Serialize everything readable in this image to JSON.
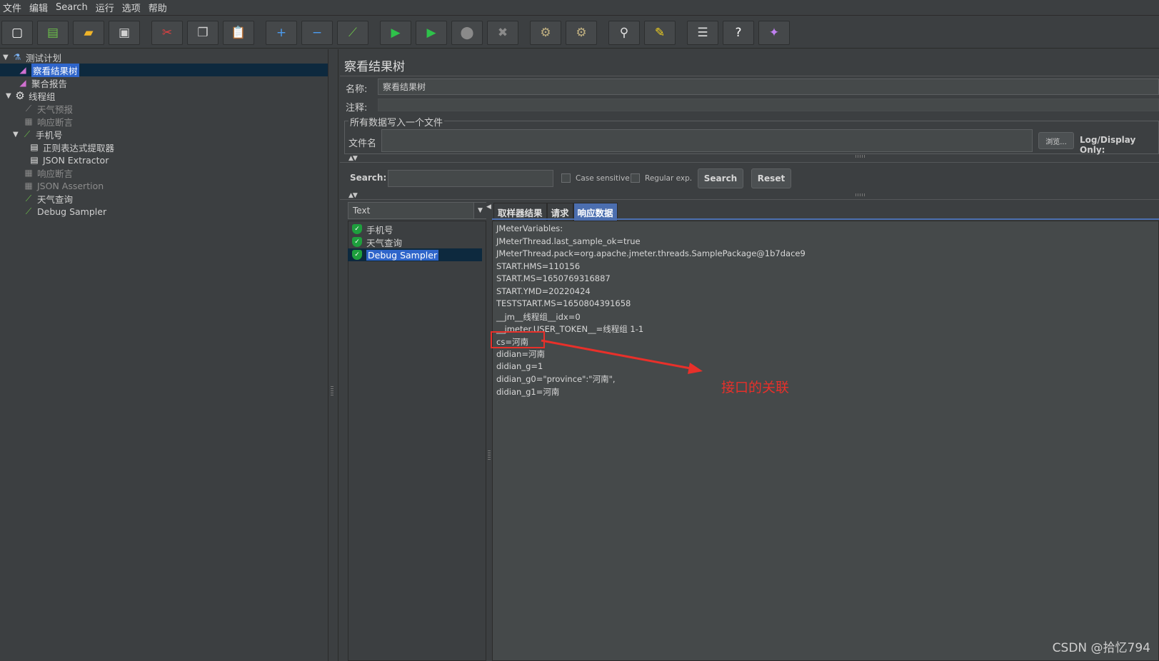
{
  "menu": [
    "文件",
    "编辑",
    "Search",
    "运行",
    "选项",
    "帮助"
  ],
  "toolbar": [
    {
      "icon": "new-icon",
      "glyph": "▢",
      "color": "#ffffff"
    },
    {
      "icon": "templates-icon",
      "glyph": "▤",
      "color": "#6cc04a"
    },
    {
      "icon": "open-icon",
      "glyph": "▰",
      "color": "#f0b429"
    },
    {
      "icon": "save-icon",
      "glyph": "▣",
      "color": "#d0d0d0"
    },
    {
      "icon": "cut-icon",
      "glyph": "✂",
      "color": "#e04040"
    },
    {
      "icon": "copy-icon",
      "glyph": "❐",
      "color": "#d0d0d0"
    },
    {
      "icon": "paste-icon",
      "glyph": "📋",
      "color": "#f0b429"
    },
    {
      "icon": "expand-icon",
      "glyph": "+",
      "color": "#4c9cf0"
    },
    {
      "icon": "collapse-icon",
      "glyph": "−",
      "color": "#4c9cf0"
    },
    {
      "icon": "toggle-icon",
      "glyph": "⟋",
      "color": "#6cc04a"
    },
    {
      "icon": "start-icon",
      "glyph": "▶",
      "color": "#2ec24a"
    },
    {
      "icon": "start-no-pause-icon",
      "glyph": "▶",
      "color": "#2ec24a"
    },
    {
      "icon": "stop-icon",
      "glyph": "⬤",
      "color": "#8a8a8a"
    },
    {
      "icon": "shutdown-icon",
      "glyph": "✖",
      "color": "#8a8a8a"
    },
    {
      "icon": "clear-icon",
      "glyph": "⚙",
      "color": "#c0b080"
    },
    {
      "icon": "clear-all-icon",
      "glyph": "⚙",
      "color": "#c0b080"
    },
    {
      "icon": "search-icon",
      "glyph": "⚲",
      "color": "#e0e0e0"
    },
    {
      "icon": "reset-search-icon",
      "glyph": "✎",
      "color": "#f0d020"
    },
    {
      "icon": "function-helper-icon",
      "glyph": "☰",
      "color": "#e0e0e0"
    },
    {
      "icon": "help-icon",
      "glyph": "?",
      "color": "#ffffff"
    },
    {
      "icon": "remote-icon",
      "glyph": "✦",
      "color": "#c080f0"
    }
  ],
  "tree": {
    "test_plan": "测试计划",
    "view_results_tree": "察看结果树",
    "aggregate_report": "聚合报告",
    "thread_group": "线程组",
    "weather_forecast": "天气预报",
    "response_assertion_1": "响应断言",
    "phone_number": "手机号",
    "regex_extractor": "正则表达式提取器",
    "json_extractor": "JSON Extractor",
    "response_assertion_2": "响应断言",
    "json_assertion": "JSON Assertion",
    "weather_query": "天气查询",
    "debug_sampler": "Debug Sampler"
  },
  "panel": {
    "title": "察看结果树",
    "name_label": "名称:",
    "name_value": "察看结果树",
    "comment_label": "注释:",
    "comment_value": "",
    "file_group_title": "所有数据写入一个文件",
    "filename_label": "文件名",
    "filename_value": "",
    "browse_label": "浏览...",
    "log_display_label": "Log/Display Only:"
  },
  "search": {
    "label": "Search:",
    "value": "",
    "case_sensitive": "Case sensitive",
    "regular_exp": "Regular exp.",
    "search_button": "Search",
    "reset_button": "Reset"
  },
  "results": {
    "renderer": "Text",
    "samples": [
      "手机号",
      "天气查询",
      "Debug Sampler"
    ],
    "selected_index": 2
  },
  "tabs": [
    "取样器结果",
    "请求",
    "响应数据"
  ],
  "active_tab": 2,
  "response_lines": [
    "JMeterVariables:",
    "JMeterThread.last_sample_ok=true",
    "JMeterThread.pack=org.apache.jmeter.threads.SamplePackage@1b7dace9",
    "START.HMS=110156",
    "START.MS=1650769316887",
    "START.YMD=20220424",
    "TESTSTART.MS=1650804391658",
    "__jm__线程组__idx=0",
    "__jmeter.USER_TOKEN__=线程组 1-1",
    "cs=河南",
    "didian=河南",
    "didian_g=1",
    "didian_g0=\"province\":\"河南\",",
    "didian_g1=河南"
  ],
  "annotation": "接口的关联",
  "watermark": "CSDN @拾忆794",
  "colors": {
    "highlight": "#e8302a",
    "selection": "#2f65ca",
    "active_tab": "#4b6eaf"
  }
}
